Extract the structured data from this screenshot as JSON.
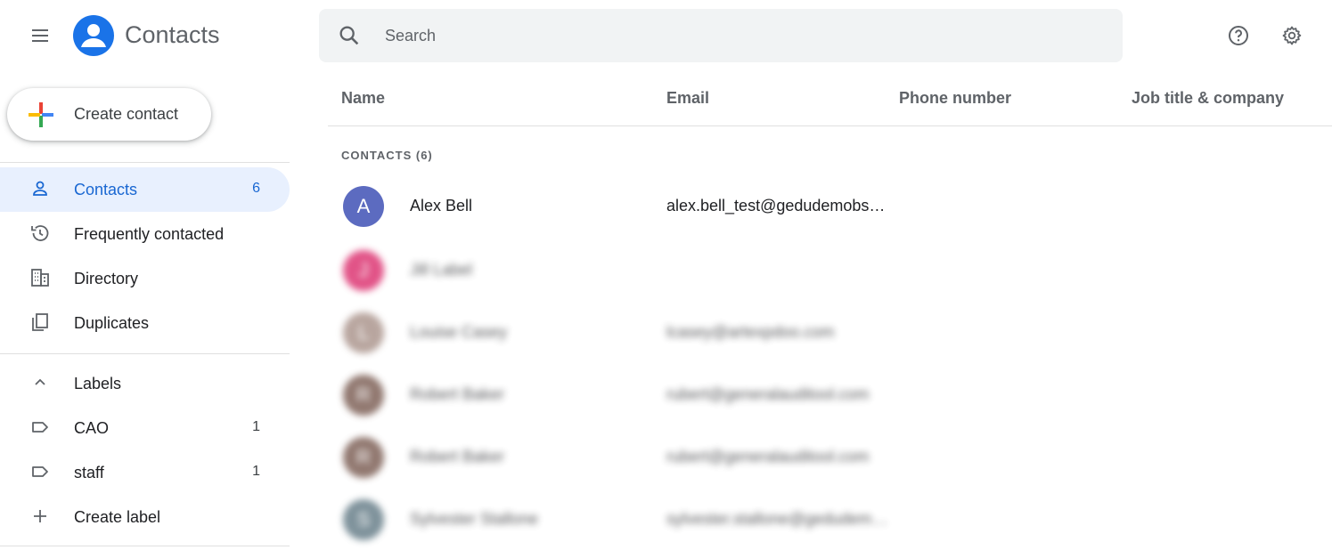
{
  "app": {
    "title": "Contacts"
  },
  "search": {
    "placeholder": "Search"
  },
  "create_button": {
    "label": "Create contact"
  },
  "sidebar": {
    "items": [
      {
        "label": "Contacts",
        "count": "6",
        "icon": "person-icon",
        "active": true
      },
      {
        "label": "Frequently contacted",
        "count": "",
        "icon": "history-icon"
      },
      {
        "label": "Directory",
        "count": "",
        "icon": "building-icon"
      },
      {
        "label": "Duplicates",
        "count": "",
        "icon": "copy-icon"
      }
    ],
    "labels_header": "Labels",
    "labels": [
      {
        "label": "CAO",
        "count": "1"
      },
      {
        "label": "staff",
        "count": "1"
      }
    ],
    "create_label": "Create label"
  },
  "table": {
    "columns": [
      "Name",
      "Email",
      "Phone number",
      "Job title & company"
    ],
    "section_label": "CONTACTS (6)",
    "rows": [
      {
        "initial": "A",
        "name": "Alex Bell",
        "email": "alex.bell_test@gedudemobsn…",
        "avatar_color": "#5c6bc0"
      },
      {
        "initial": "J",
        "name": "Jill Label",
        "email": "",
        "avatar_color": "#d81b60"
      },
      {
        "initial": "L",
        "name": "Louise Casey",
        "email": "lcasey@artexpdoo.com",
        "avatar_color": "#a1887f"
      },
      {
        "initial": "R",
        "name": "Robert Baker",
        "email": "rubert@generalauditool.com",
        "avatar_color": "#6d4c41"
      },
      {
        "initial": "R",
        "name": "Robert Baker",
        "email": "rubert@generalauditool.com",
        "avatar_color": "#6d4c41"
      },
      {
        "initial": "S",
        "name": "Sylvester Stallone",
        "email": "sylvester.stallone@gedudem…",
        "avatar_color": "#546e7a"
      }
    ]
  }
}
